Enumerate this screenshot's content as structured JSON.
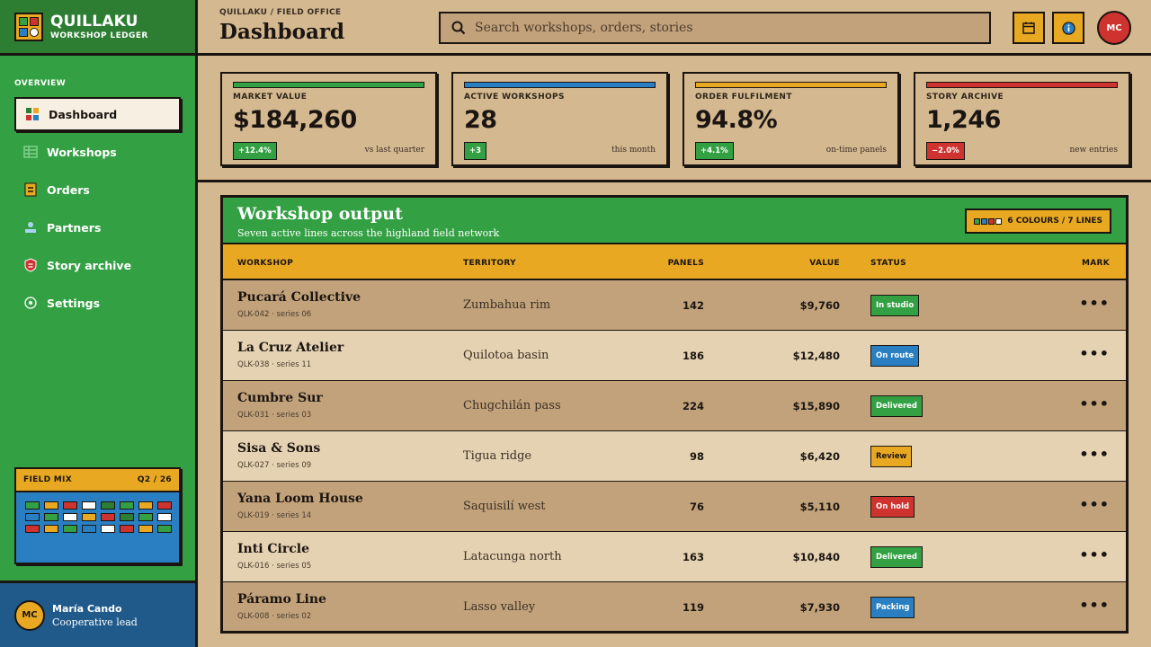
{
  "brand": {
    "title": "QUILLAKU",
    "subtitle": "WORKSHOP LEDGER"
  },
  "sidebar": {
    "section_label": "OVERVIEW",
    "items": [
      {
        "label": "Dashboard",
        "icon": "grid-icon",
        "active": true
      },
      {
        "label": "Workshops",
        "icon": "table-icon",
        "active": false
      },
      {
        "label": "Orders",
        "icon": "orders-icon",
        "active": false
      },
      {
        "label": "Partners",
        "icon": "partner-icon",
        "active": false
      },
      {
        "label": "Story archive",
        "icon": "shield-icon",
        "active": false
      },
      {
        "label": "Settings",
        "icon": "gear-icon",
        "active": false
      }
    ],
    "field_mix": {
      "title": "FIELD MIX",
      "period": "Q2 / 26",
      "cells": [
        "green",
        "orange",
        "red",
        "white",
        "darkgreen",
        "green",
        "orange",
        "red",
        "blue",
        "green",
        "white",
        "orange",
        "red",
        "darkgreen",
        "green",
        "white",
        "red",
        "orange",
        "green",
        "blue",
        "white",
        "red",
        "orange",
        "green"
      ]
    },
    "user": {
      "initials": "MC",
      "name": "María Cando",
      "role": "Cooperative lead"
    }
  },
  "header": {
    "breadcrumb": "QUILLAKU / FIELD OFFICE",
    "title": "Dashboard",
    "search_placeholder": "Search workshops, orders, stories",
    "avatar_initials": "MC"
  },
  "kpis": [
    {
      "label": "MARKET VALUE",
      "value": "$184,260",
      "delta": "+12.4%",
      "note": "vs last quarter",
      "color": "#33a043",
      "delta_color": "#33a043"
    },
    {
      "label": "ACTIVE WORKSHOPS",
      "value": "28",
      "delta": "+3",
      "note": "this month",
      "color": "#2a7fc2",
      "delta_color": "#33a043"
    },
    {
      "label": "ORDER FULFILMENT",
      "value": "94.8%",
      "delta": "+4.1%",
      "note": "on-time panels",
      "color": "#e8a822",
      "delta_color": "#33a043"
    },
    {
      "label": "STORY ARCHIVE",
      "value": "1,246",
      "delta": "−2.0%",
      "note": "new entries",
      "color": "#cf3330",
      "delta_color": "#cf3330"
    }
  ],
  "table": {
    "title": "Workshop output",
    "subtitle": "Seven active lines across the highland field network",
    "legend": "6 COLOURS / 7 LINES",
    "columns": {
      "workshop": "WORKSHOP",
      "territory": "TERRITORY",
      "panels": "PANELS",
      "value": "VALUE",
      "status": "STATUS",
      "mark": "MARK"
    },
    "rows": [
      {
        "name": "Pucará Collective",
        "code": "QLK-042 · series 06",
        "territory": "Zumbahua rim",
        "panels": "142",
        "value": "$9,760",
        "status": "In studio",
        "status_color": "#33a043",
        "status_text": "#ffffff"
      },
      {
        "name": "La Cruz Atelier",
        "code": "QLK-038 · series 11",
        "territory": "Quilotoa basin",
        "panels": "186",
        "value": "$12,480",
        "status": "On route",
        "status_color": "#2a7fc2",
        "status_text": "#ffffff"
      },
      {
        "name": "Cumbre Sur",
        "code": "QLK-031 · series 03",
        "territory": "Chugchilán pass",
        "panels": "224",
        "value": "$15,890",
        "status": "Delivered",
        "status_color": "#33a043",
        "status_text": "#ffffff"
      },
      {
        "name": "Sisa & Sons",
        "code": "QLK-027 · series 09",
        "territory": "Tigua ridge",
        "panels": "98",
        "value": "$6,420",
        "status": "Review",
        "status_color": "#e8a822",
        "status_text": "#1b1511"
      },
      {
        "name": "Yana Loom House",
        "code": "QLK-019 · series 14",
        "territory": "Saquisilí west",
        "panels": "76",
        "value": "$5,110",
        "status": "On hold",
        "status_color": "#cf3330",
        "status_text": "#ffffff"
      },
      {
        "name": "Inti Circle",
        "code": "QLK-016 · series 05",
        "territory": "Latacunga north",
        "panels": "163",
        "value": "$10,840",
        "status": "Delivered",
        "status_color": "#33a043",
        "status_text": "#ffffff"
      },
      {
        "name": "Páramo Line",
        "code": "QLK-008 · series 02",
        "territory": "Lasso valley",
        "panels": "119",
        "value": "$7,930",
        "status": "Packing",
        "status_color": "#2a7fc2",
        "status_text": "#ffffff"
      }
    ],
    "row_action": "•••"
  },
  "colors": {
    "green": "#33a043",
    "darkgreen": "#2d7d33",
    "blue": "#2a7fc2",
    "orange": "#e8a822",
    "red": "#cf3330",
    "white": "#ffffff",
    "ink": "#1b1511"
  }
}
